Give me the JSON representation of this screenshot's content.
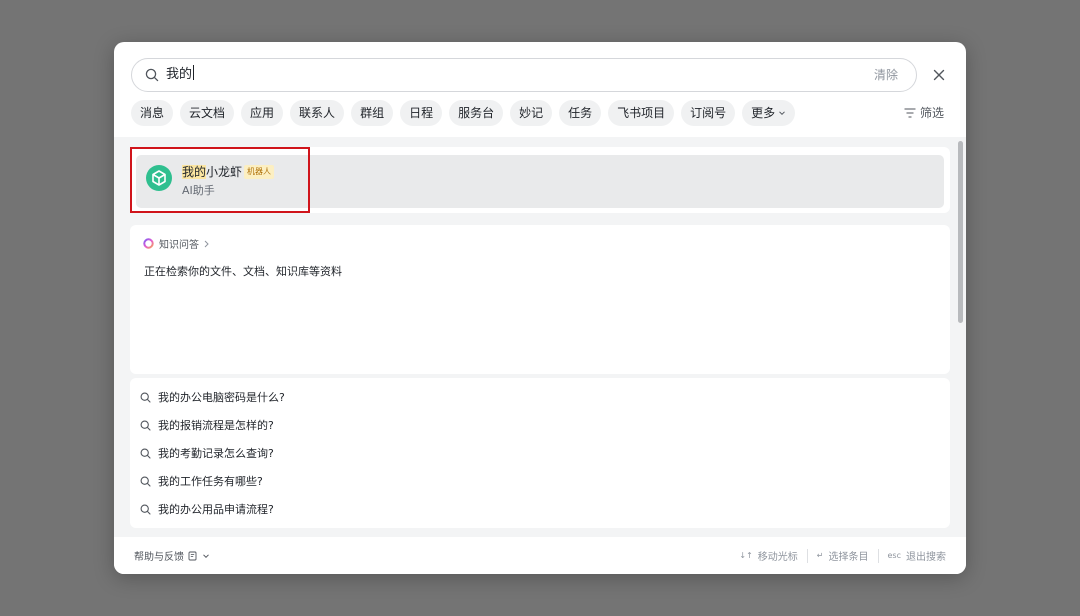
{
  "search": {
    "query": "我的",
    "clear_label": "清除"
  },
  "chips": [
    {
      "label": "消息"
    },
    {
      "label": "云文档"
    },
    {
      "label": "应用"
    },
    {
      "label": "联系人"
    },
    {
      "label": "群组"
    },
    {
      "label": "日程"
    },
    {
      "label": "服务台"
    },
    {
      "label": "妙记"
    },
    {
      "label": "任务"
    },
    {
      "label": "飞书项目"
    },
    {
      "label": "订阅号"
    },
    {
      "label": "更多"
    }
  ],
  "filter_label": "筛选",
  "bot_result": {
    "name_highlight": "我的",
    "name_rest": "小龙虾",
    "tag": "机器人",
    "subtitle": "AI助手",
    "avatar_color": "#2fbf8f"
  },
  "qa": {
    "title": "知识问答",
    "status": "正在检索你的文件、文档、知识库等资料"
  },
  "suggestions": [
    "我的办公电脑密码是什么?",
    "我的报销流程是怎样的?",
    "我的考勤记录怎么查询?",
    "我的工作任务有哪些?",
    "我的办公用品申请流程?"
  ],
  "footer": {
    "help_label": "帮助与反馈",
    "hint_move_key": "↓↑",
    "hint_move": "移动光标",
    "hint_select_key": "↵",
    "hint_select": "选择条目",
    "hint_exit_key": "esc",
    "hint_exit": "退出搜索"
  },
  "colors": {
    "backdrop": "#747474",
    "highlight": "#fbe5a1",
    "selection_border": "#d0141b"
  }
}
